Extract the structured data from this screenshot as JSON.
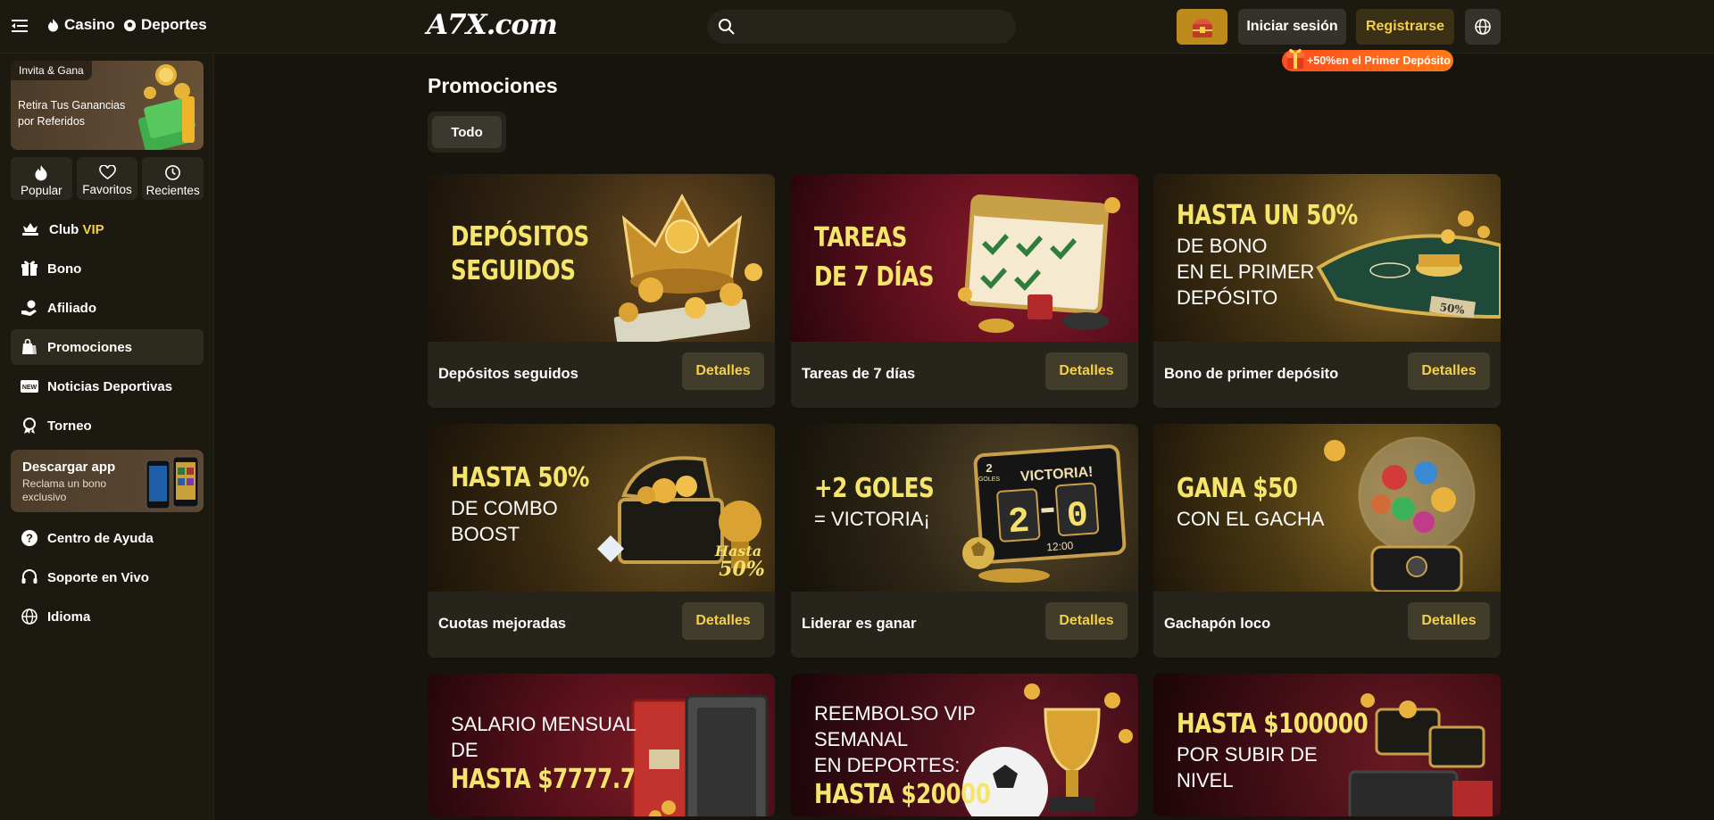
{
  "header": {
    "nav": {
      "casino": "Casino",
      "sports": "Deportes"
    },
    "logo": "A7X.com",
    "search_placeholder": "",
    "login_label": "Iniciar sesión",
    "register_label": "Registrarse",
    "promo_tag": "+50%en el Primer Depósito"
  },
  "sidebar": {
    "invite": {
      "tag": "Invita & Gana",
      "text": "Retira Tus Ganancias por Referidos"
    },
    "quick": [
      "Popular",
      "Favoritos",
      "Recientes"
    ],
    "club": {
      "prefix": "Club",
      "vip": "VIP"
    },
    "items": [
      "Bono",
      "Afiliado",
      "Promociones",
      "Noticias Deportivas",
      "Torneo"
    ],
    "app": {
      "title": "Descargar app",
      "subtitle": "Reclama un bono exclusivo"
    },
    "support": [
      "Centro de Ayuda",
      "Soporte en Vivo",
      "Idioma"
    ]
  },
  "main": {
    "title": "Promociones",
    "filter_all": "Todo",
    "details_label": "Detalles",
    "cards": [
      {
        "name": "Depósitos seguidos",
        "banner_big": [
          "DEPÓSITOS",
          "SEGUIDOS"
        ],
        "banner_small": []
      },
      {
        "name": "Tareas de 7 días",
        "banner_big": [
          "TAREAS",
          "DE 7 DÍAS"
        ],
        "banner_small": []
      },
      {
        "name": "Bono de primer depósito",
        "banner_big": [
          "HASTA UN 50%"
        ],
        "banner_small": [
          "DE BONO",
          "EN EL PRIMER",
          "DEPÓSITO"
        ]
      },
      {
        "name": "Cuotas mejoradas",
        "banner_big": [
          "HASTA 50%"
        ],
        "banner_small": [
          "DE COMBO",
          "BOOST"
        ]
      },
      {
        "name": "Liderar es ganar",
        "banner_big": [
          "+2 GOLES"
        ],
        "banner_small": [
          "= VICTORIA¡"
        ]
      },
      {
        "name": "Gachapón loco",
        "banner_big": [
          "GANA $50"
        ],
        "banner_small": [
          "CON EL GACHA"
        ]
      },
      {
        "name": "",
        "banner_big": [
          "HASTA $7777.7"
        ],
        "banner_small": [
          "SALARIO MENSUAL",
          "DE"
        ]
      },
      {
        "name": "",
        "banner_big": [
          "HASTA $20000"
        ],
        "banner_small": [
          "REEMBOLSO VIP",
          "SEMANAL",
          "EN DEPORTES:"
        ]
      },
      {
        "name": "",
        "banner_big": [
          "HASTA $100000"
        ],
        "banner_small": [
          "POR SUBIR DE",
          "NIVEL"
        ]
      }
    ],
    "banner_decor": {
      "table_badge": "50%",
      "chest_badge": [
        "Hasta",
        "50%"
      ],
      "score": [
        "VICTORIA!",
        "2",
        "0",
        "12:00"
      ],
      "goles_label": [
        "2",
        "GOLES"
      ]
    }
  },
  "colors": {
    "background": "#16140d",
    "accent": "#f5cf45",
    "panel": "#26241b",
    "banner_headline": "#f5e66b",
    "promo_tag": "#ff5a1f"
  }
}
